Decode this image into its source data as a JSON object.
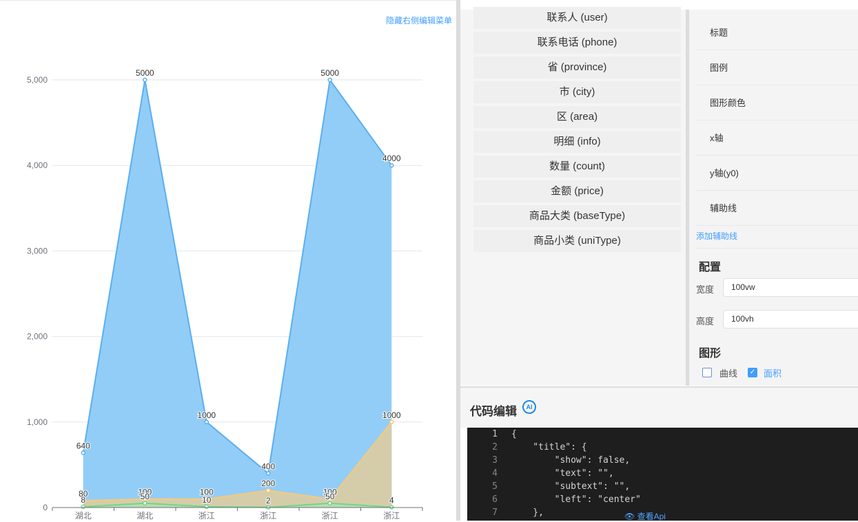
{
  "left_panel": {
    "hide_menu_link": "隐藏右侧编辑菜单"
  },
  "chart_data": {
    "type": "area",
    "categories": [
      "湖北",
      "湖北",
      "浙江",
      "浙江",
      "浙江",
      "浙江"
    ],
    "ylim": [
      0,
      5000
    ],
    "yticks": [
      "0",
      "1,000",
      "2,000",
      "3,000",
      "4,000",
      "5,000"
    ],
    "grid": true,
    "series": [
      {
        "values": [
          640,
          5000,
          1000,
          400,
          5000,
          4000
        ],
        "color": "#5aaef0",
        "fill": "#92cdf7"
      },
      {
        "values": [
          80,
          100,
          100,
          200,
          100,
          1000
        ],
        "color": "#f7c97a",
        "fill": "#d9cca4"
      },
      {
        "values": [
          8,
          50,
          10,
          2,
          50,
          4
        ],
        "color": "#6fd68a",
        "fill": "#b7dcb0"
      }
    ]
  },
  "fields": [
    "联系人 (user)",
    "联系电话 (phone)",
    "省 (province)",
    "市 (city)",
    "区 (area)",
    "明细 (info)",
    "数量 (count)",
    "金额 (price)",
    "商品大类 (baseType)",
    "商品小类 (uniType)"
  ],
  "props": {
    "rows": [
      "标题",
      "图例",
      "图形颜色",
      "x轴",
      "y轴(y0)",
      "辅助线"
    ],
    "add_guide": "添加辅助线"
  },
  "config": {
    "title": "配置",
    "width_label": "宽度",
    "width_value": "100vw",
    "height_label": "高度",
    "height_value": "100vh"
  },
  "shape": {
    "title": "图形",
    "curve_label": "曲线",
    "curve_checked": false,
    "area_label": "面积",
    "area_checked": true
  },
  "code": {
    "title": "代码编辑",
    "ai_label": "AI",
    "api_link": "查看Api",
    "lines": [
      "{",
      "    \"title\": {",
      "        \"show\": false,",
      "        \"text\": \"\",",
      "        \"subtext\": \"\",",
      "        \"left\": \"center\"",
      "    },"
    ]
  }
}
